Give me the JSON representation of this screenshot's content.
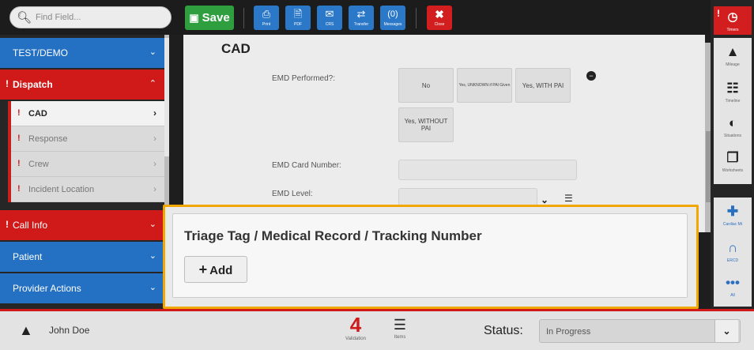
{
  "search": {
    "placeholder": "Find Field..."
  },
  "toolbar": {
    "save_label": "Save",
    "buttons": [
      {
        "label": "Print",
        "icon": "print-icon"
      },
      {
        "label": "PDF",
        "icon": "pdf-icon"
      },
      {
        "label": "CRS",
        "icon": "crs-icon"
      },
      {
        "label": "Transfer",
        "icon": "transfer-icon"
      },
      {
        "label": "Messages",
        "count": "(0)"
      }
    ],
    "close_label": "Close"
  },
  "sidebar": {
    "sections": [
      {
        "label": "TEST/DEMO",
        "color": "blue"
      },
      {
        "label": "Dispatch",
        "color": "red",
        "expanded": true
      },
      {
        "label": "Call Info",
        "color": "red"
      },
      {
        "label": "Patient",
        "color": "blue"
      },
      {
        "label": "Provider Actions",
        "color": "blue"
      }
    ],
    "subitems": [
      {
        "label": "CAD",
        "active": true
      },
      {
        "label": "Response"
      },
      {
        "label": "Crew"
      },
      {
        "label": "Incident Location"
      }
    ]
  },
  "cad": {
    "title": "CAD",
    "emd_performed_label": "EMD Performed?:",
    "emd_options": [
      "No",
      "Yes, UNKNOWN if PAI Given",
      "Yes, WITH PAI",
      "Yes, WITHOUT PAI"
    ],
    "emd_card_label": "EMD Card Number:",
    "emd_level_label": "EMD Level:"
  },
  "triage": {
    "title": "Triage Tag / Medical Record / Tracking Number",
    "add_label": "Add"
  },
  "rail": {
    "timer_label": "Timers",
    "items": [
      {
        "label": "Mileage",
        "icon": "mileage-icon"
      },
      {
        "label": "Timeline",
        "icon": "timeline-icon"
      },
      {
        "label": "Situations",
        "icon": "situations-icon"
      },
      {
        "label": "Worksheets",
        "icon": "worksheets-icon"
      },
      {
        "label": "Cardiac Mt",
        "icon": "medkit-icon"
      },
      {
        "label": "ERCD",
        "icon": "lungs-icon"
      },
      {
        "label": "All",
        "icon": "more-icon"
      }
    ]
  },
  "footer": {
    "user_name": "John Doe",
    "validation_count": "4",
    "validation_label": "Validation",
    "items_label": "Items",
    "status_label": "Status:",
    "status_value": "In Progress"
  },
  "colors": {
    "accent_red": "#d01a1a",
    "accent_blue": "#2470c2",
    "save_green": "#2e9e3f",
    "highlight_orange": "#f0a800"
  }
}
